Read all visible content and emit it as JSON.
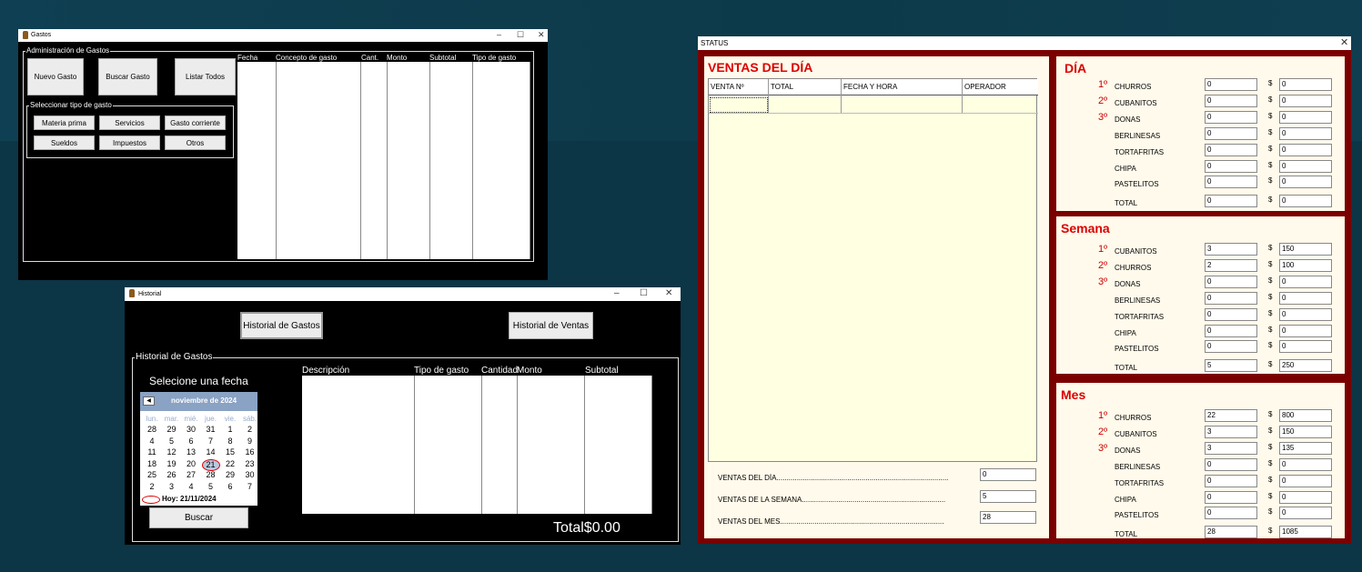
{
  "gastos": {
    "title": "Gastos",
    "group_title": "Administración de Gastos",
    "buttons": {
      "nuevo": "Nuevo Gasto",
      "buscar": "Buscar Gasto",
      "listar": "Listar Todos"
    },
    "tipo_group_title": "Seleccionar tipo de gasto",
    "tipos": [
      "Materia prima",
      "Servicios",
      "Gasto corriente",
      "Sueldos",
      "Impuestos",
      "Otros"
    ],
    "columns": [
      "Fecha",
      "Concepto de gasto",
      "Cant.",
      "Monto",
      "Subtotal",
      "Tipo de gasto"
    ],
    "controls": {
      "min": "–",
      "max": "☐",
      "close": "✕"
    }
  },
  "historial": {
    "title": "Historial",
    "btn_gastos": "Historial de Gastos",
    "btn_ventas": "Historial de Ventas",
    "group_title": "Historial de Gastos",
    "select_date": "Selecione una fecha",
    "calendar": {
      "month": "noviembre de 2024",
      "weekdays": [
        "lun.",
        "mar.",
        "mié.",
        "jue.",
        "vie.",
        "sáb."
      ],
      "weeks": [
        [
          "28",
          "29",
          "30",
          "31",
          "1",
          "2"
        ],
        [
          "4",
          "5",
          "6",
          "7",
          "8",
          "9"
        ],
        [
          "11",
          "12",
          "13",
          "14",
          "15",
          "16"
        ],
        [
          "18",
          "19",
          "20",
          "21",
          "22",
          "23"
        ],
        [
          "25",
          "26",
          "27",
          "28",
          "29",
          "30"
        ],
        [
          "2",
          "3",
          "4",
          "5",
          "6",
          "7"
        ]
      ],
      "today": "Hoy: 21/11/2024"
    },
    "search": "Buscar",
    "columns": [
      "Descripción",
      "Tipo de gasto",
      "Cantidad",
      "Monto",
      "Subtotal"
    ],
    "total": "Total$0.00",
    "controls": {
      "min": "–",
      "max": "☐",
      "close": "✕"
    }
  },
  "status": {
    "title": "STATUS",
    "close": "✕",
    "ventas_title": "VENTAS DEL DÍA",
    "columns": [
      "VENTA Nº",
      "TOTAL",
      "FECHA Y HORA",
      "OPERADOR"
    ],
    "summary": [
      {
        "label": "VENTAS DEL DÍA.....................................................................................",
        "value": "0"
      },
      {
        "label": "VENTAS DE LA SEMANA.......................................................................",
        "value": "5"
      },
      {
        "label": "VENTAS DEL MES.................................................................................",
        "value": "28"
      }
    ],
    "panels": [
      {
        "title": "DÍA",
        "ranks": [
          "1º",
          "2º",
          "3º"
        ],
        "items": [
          {
            "name": "CHURROS",
            "qty": "0",
            "amt": "0"
          },
          {
            "name": "CUBANITOS",
            "qty": "0",
            "amt": "0"
          },
          {
            "name": "DONAS",
            "qty": "0",
            "amt": "0"
          },
          {
            "name": "BERLINESAS",
            "qty": "0",
            "amt": "0"
          },
          {
            "name": "TORTAFRITAS",
            "qty": "0",
            "amt": "0"
          },
          {
            "name": "CHIPA",
            "qty": "0",
            "amt": "0"
          },
          {
            "name": "PASTELITOS",
            "qty": "0",
            "amt": "0"
          },
          {
            "name": "TOTAL",
            "qty": "0",
            "amt": "0"
          }
        ]
      },
      {
        "title": "Semana",
        "ranks": [
          "1º",
          "2º",
          "3º"
        ],
        "items": [
          {
            "name": "CUBANITOS",
            "qty": "3",
            "amt": "150"
          },
          {
            "name": "CHURROS",
            "qty": "2",
            "amt": "100"
          },
          {
            "name": "DONAS",
            "qty": "0",
            "amt": "0"
          },
          {
            "name": "BERLINESAS",
            "qty": "0",
            "amt": "0"
          },
          {
            "name": "TORTAFRITAS",
            "qty": "0",
            "amt": "0"
          },
          {
            "name": "CHIPA",
            "qty": "0",
            "amt": "0"
          },
          {
            "name": "PASTELITOS",
            "qty": "0",
            "amt": "0"
          },
          {
            "name": "TOTAL",
            "qty": "5",
            "amt": "250"
          }
        ]
      },
      {
        "title": "Mes",
        "ranks": [
          "1º",
          "2º",
          "3º"
        ],
        "items": [
          {
            "name": "CHURROS",
            "qty": "22",
            "amt": "800"
          },
          {
            "name": "CUBANITOS",
            "qty": "3",
            "amt": "150"
          },
          {
            "name": "DONAS",
            "qty": "3",
            "amt": "135"
          },
          {
            "name": "BERLINESAS",
            "qty": "0",
            "amt": "0"
          },
          {
            "name": "TORTAFRITAS",
            "qty": "0",
            "amt": "0"
          },
          {
            "name": "CHIPA",
            "qty": "0",
            "amt": "0"
          },
          {
            "name": "PASTELITOS",
            "qty": "0",
            "amt": "0"
          },
          {
            "name": "TOTAL",
            "qty": "28",
            "amt": "1085"
          }
        ]
      }
    ],
    "currency": "$"
  }
}
